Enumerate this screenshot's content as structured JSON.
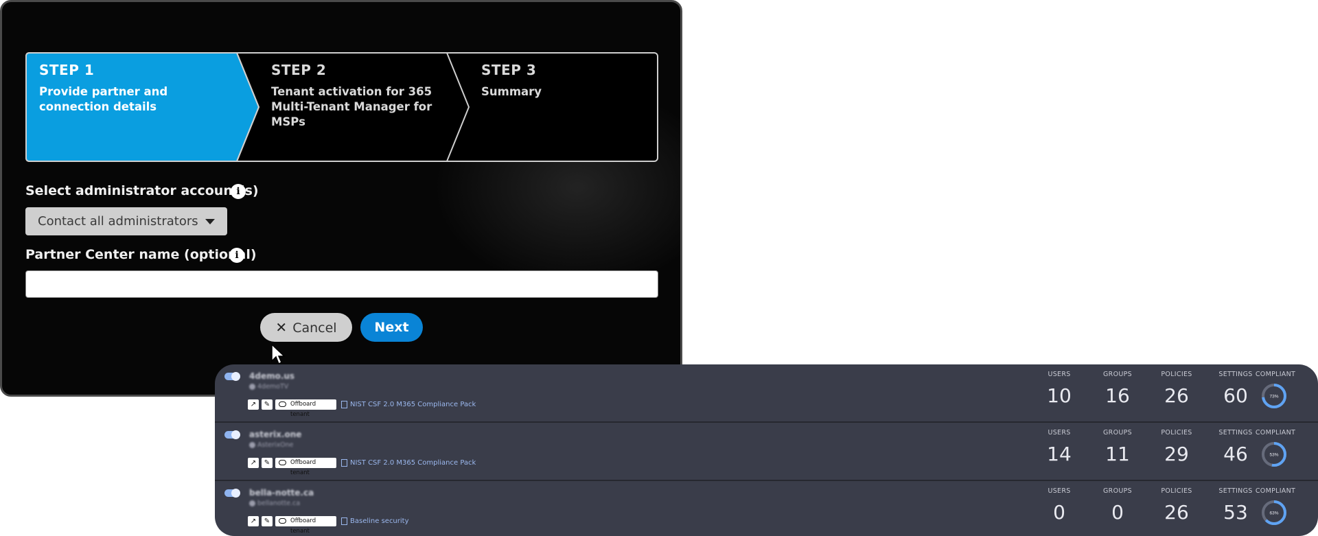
{
  "dialog": {
    "steps": [
      {
        "title": "STEP 1",
        "desc": "Provide partner and connection details"
      },
      {
        "title": "STEP 2",
        "desc": "Tenant activation for 365 Multi-Tenant Manager for MSPs"
      },
      {
        "title": "STEP 3",
        "desc": "Summary"
      }
    ],
    "admin_label": "Select administrator account(s)",
    "admin_selected": "Contact all administrators",
    "partner_label": "Partner Center name (optional)",
    "partner_value": "",
    "info_glyph": "i",
    "cancel_label": "Cancel",
    "next_label": "Next",
    "colors": {
      "active_step": "#0a9ee0",
      "next_button": "#0a84d6"
    }
  },
  "tenants": {
    "headers": {
      "users": "USERS",
      "groups": "GROUPS",
      "policies": "POLICIES",
      "settings": "SETTINGS",
      "compliant": "COMPLIANT"
    },
    "offboard_label": "Offboard tenant",
    "rows": [
      {
        "name": "4demo.us",
        "sub": "4demoTV",
        "pack": "NIST CSF 2.0 M365 Compliance Pack",
        "users": "10",
        "groups": "16",
        "policies": "26",
        "settings": "60",
        "compliant_label": "73%",
        "compliant": 0.73
      },
      {
        "name": "asterix.one",
        "sub": "AsterixOne",
        "pack": "NIST CSF 2.0 M365 Compliance Pack",
        "users": "14",
        "groups": "11",
        "policies": "29",
        "settings": "46",
        "compliant_label": "53%",
        "compliant": 0.53
      },
      {
        "name": "bella-notte.ca",
        "sub": "bellanotte.ca",
        "pack": "Baseline security",
        "users": "0",
        "groups": "0",
        "policies": "26",
        "settings": "53",
        "compliant_label": "63%",
        "compliant": 0.63
      }
    ]
  }
}
